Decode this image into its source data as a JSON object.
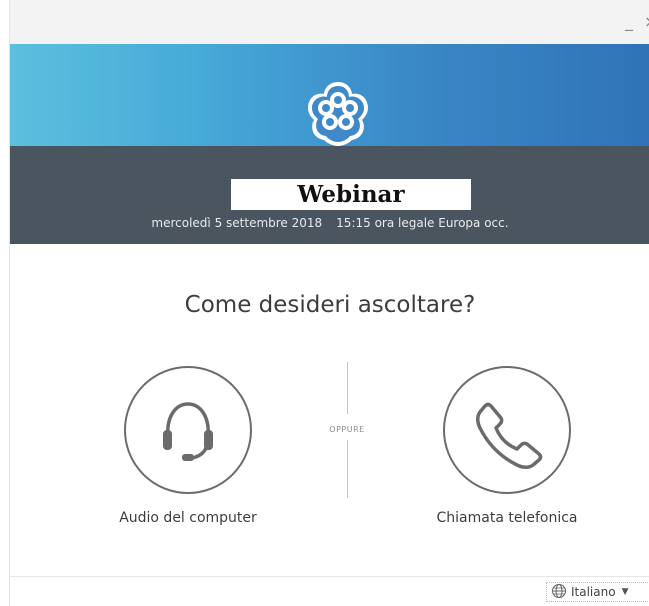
{
  "window": {
    "minimize_glyph": "_",
    "close_glyph": "×"
  },
  "header": {
    "title": "Webinar",
    "date": "mercoledì 5 settembre 2018",
    "time": "15:15 ora legale Europa occ."
  },
  "main": {
    "question": "Come desideri ascoltare?",
    "separator": "OPPURE",
    "options": [
      {
        "label": "Audio del computer",
        "icon": "headset-icon"
      },
      {
        "label": "Chiamata telefonica",
        "icon": "phone-icon"
      }
    ]
  },
  "footer": {
    "language": "Italiano",
    "language_icon": "globe-icon"
  },
  "colors": {
    "banner_start": "#5bc0de",
    "banner_end": "#2f73b6",
    "dark_band": "#4a5560",
    "icon_stroke": "#6b6b6b"
  }
}
